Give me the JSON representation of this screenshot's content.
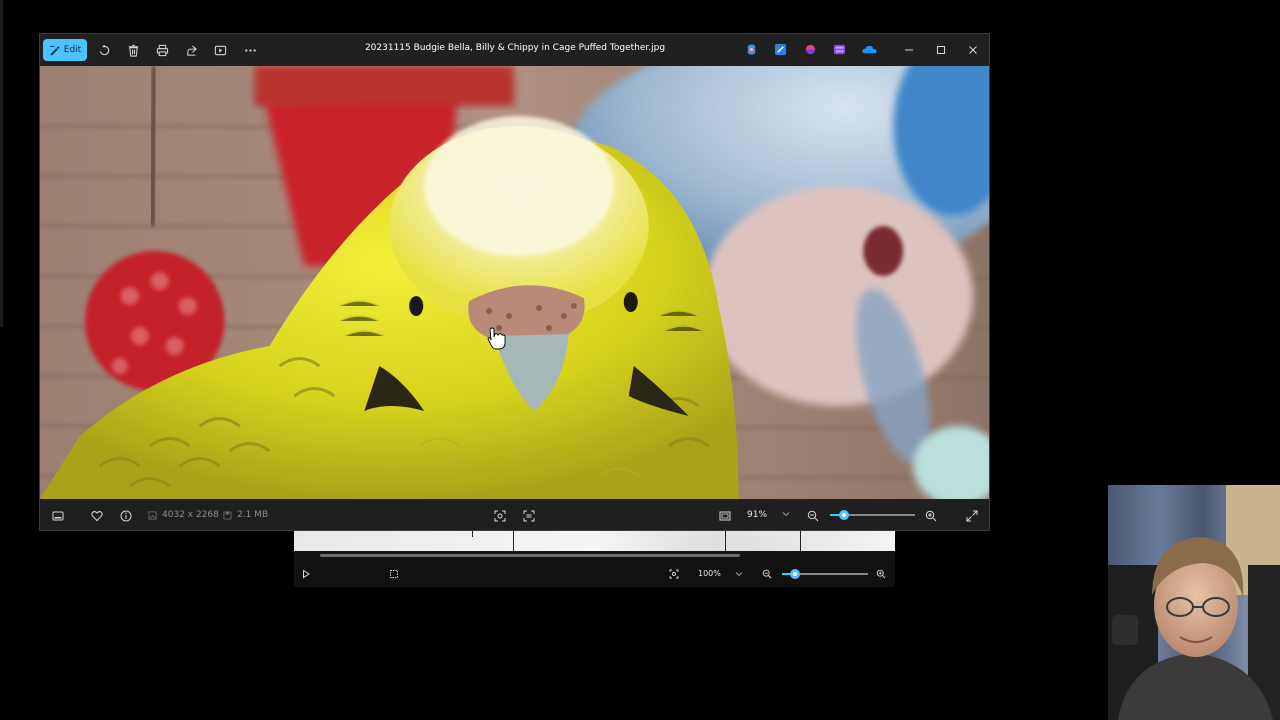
{
  "window": {
    "title": "20231115 Budgie Bella, Billy & Chippy in Cage Puffed Together.jpg",
    "toolbar": {
      "edit_label": "Edit",
      "icons": [
        "rotate-icon",
        "delete-icon",
        "print-icon",
        "share-icon",
        "slideshow-icon",
        "more-icon"
      ]
    },
    "app_icons": [
      "copilot-icon",
      "designer-icon",
      "clipchamp-icon",
      "video-editor-icon",
      "onedrive-icon"
    ],
    "controls": [
      "minimize-icon",
      "maximize-icon",
      "close-icon"
    ]
  },
  "bottom_bar": {
    "dimensions": "4032 x 2268",
    "file_size": "2.1 MB",
    "zoom_label": "91%",
    "zoom_fraction": 0.16
  },
  "second_viewer": {
    "zoom_label": "100%",
    "zoom_fraction": 0.15
  },
  "colors": {
    "accent": "#4cc2ff",
    "window_bg": "#1f1f1f",
    "text": "#e6e6e6",
    "muted": "#8a8a8a"
  }
}
